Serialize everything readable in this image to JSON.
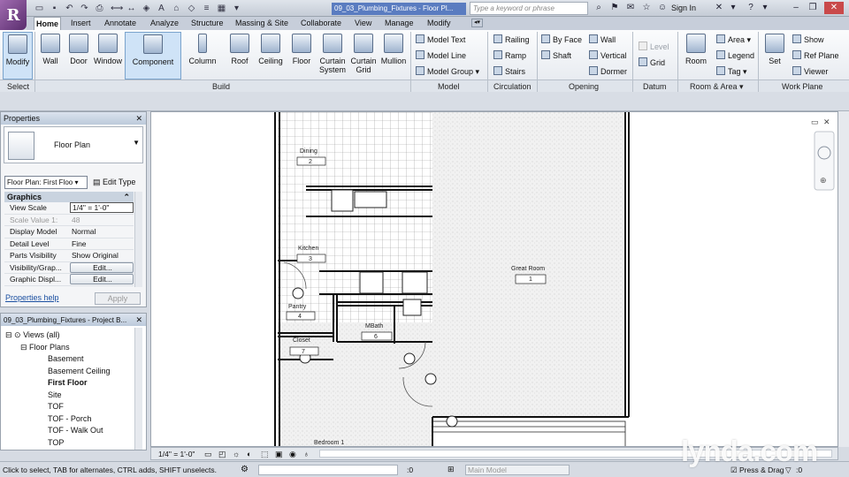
{
  "titlebar": {
    "doc_title": "09_03_Plumbing_Fixtures - Floor Pl...",
    "search_placeholder": "Type a keyword or phrase",
    "sign_in": "Sign In",
    "help": "?"
  },
  "tabs": [
    "Home",
    "Insert",
    "Annotate",
    "Analyze",
    "Structure",
    "Massing & Site",
    "Collaborate",
    "View",
    "Manage",
    "Modify"
  ],
  "ribbon": {
    "modify": "Modify",
    "build": [
      "Wall",
      "Door",
      "Window",
      "Component",
      "Column",
      "Roof",
      "Ceiling",
      "Floor",
      "Curtain System",
      "Curtain Grid",
      "Mullion"
    ],
    "model": [
      "Model Text",
      "Model Line",
      "Model Group"
    ],
    "circulation": [
      "Railing",
      "Ramp",
      "Stairs"
    ],
    "opening": [
      "By Face",
      "Shaft",
      "Wall",
      "Vertical",
      "Dormer"
    ],
    "datum": [
      "Level",
      "Grid"
    ],
    "room_big": "Room",
    "room_area": [
      "Area",
      "Legend",
      "Tag"
    ],
    "workplane_big": "Set",
    "workplane": [
      "Show",
      "Ref Plane",
      "Viewer"
    ],
    "panels": [
      "Select",
      "Build",
      "Model",
      "Circulation",
      "Opening",
      "Datum",
      "Room & Area",
      "Work Plane"
    ]
  },
  "properties": {
    "title": "Properties",
    "type_name": "Floor Plan",
    "instance_selector": "Floor Plan: First Floo",
    "edit_type": "Edit Type",
    "group": "Graphics",
    "rows": [
      {
        "k": "View Scale",
        "v": "1/4\" = 1'-0\""
      },
      {
        "k": "Scale Value    1:",
        "v": "48"
      },
      {
        "k": "Display Model",
        "v": "Normal"
      },
      {
        "k": "Detail Level",
        "v": "Fine"
      },
      {
        "k": "Parts Visibility",
        "v": "Show Original"
      },
      {
        "k": "Visibility/Grap...",
        "v": "Edit..."
      },
      {
        "k": "Graphic Displ...",
        "v": "Edit..."
      }
    ],
    "help_link": "Properties help",
    "apply": "Apply"
  },
  "browser": {
    "title": "09_03_Plumbing_Fixtures - Project B...",
    "root": "Views (all)",
    "group": "Floor Plans",
    "items": [
      "Basement",
      "Basement Ceiling",
      "First Floor",
      "Site",
      "TOF",
      "TOF - Porch",
      "TOF - Walk Out",
      "TOP"
    ]
  },
  "rooms": [
    {
      "name": "Dining",
      "num": "2"
    },
    {
      "name": "Kitchen",
      "num": "3"
    },
    {
      "name": "Pantry",
      "num": "4"
    },
    {
      "name": "MBath",
      "num": "6"
    },
    {
      "name": "Closet",
      "num": "7"
    },
    {
      "name": "Great Room",
      "num": "1"
    },
    {
      "name": "Bedroom 1",
      "num": ""
    }
  ],
  "view_control": {
    "scale": "1/4\" = 1'-0\""
  },
  "status": {
    "text": "Click to select, TAB for alternates, CTRL adds, SHIFT unselects.",
    "zero1": ":0",
    "model": "Main Model",
    "press_drag": "Press & Drag",
    "zero2": ":0"
  },
  "watermark": "lynda.com"
}
